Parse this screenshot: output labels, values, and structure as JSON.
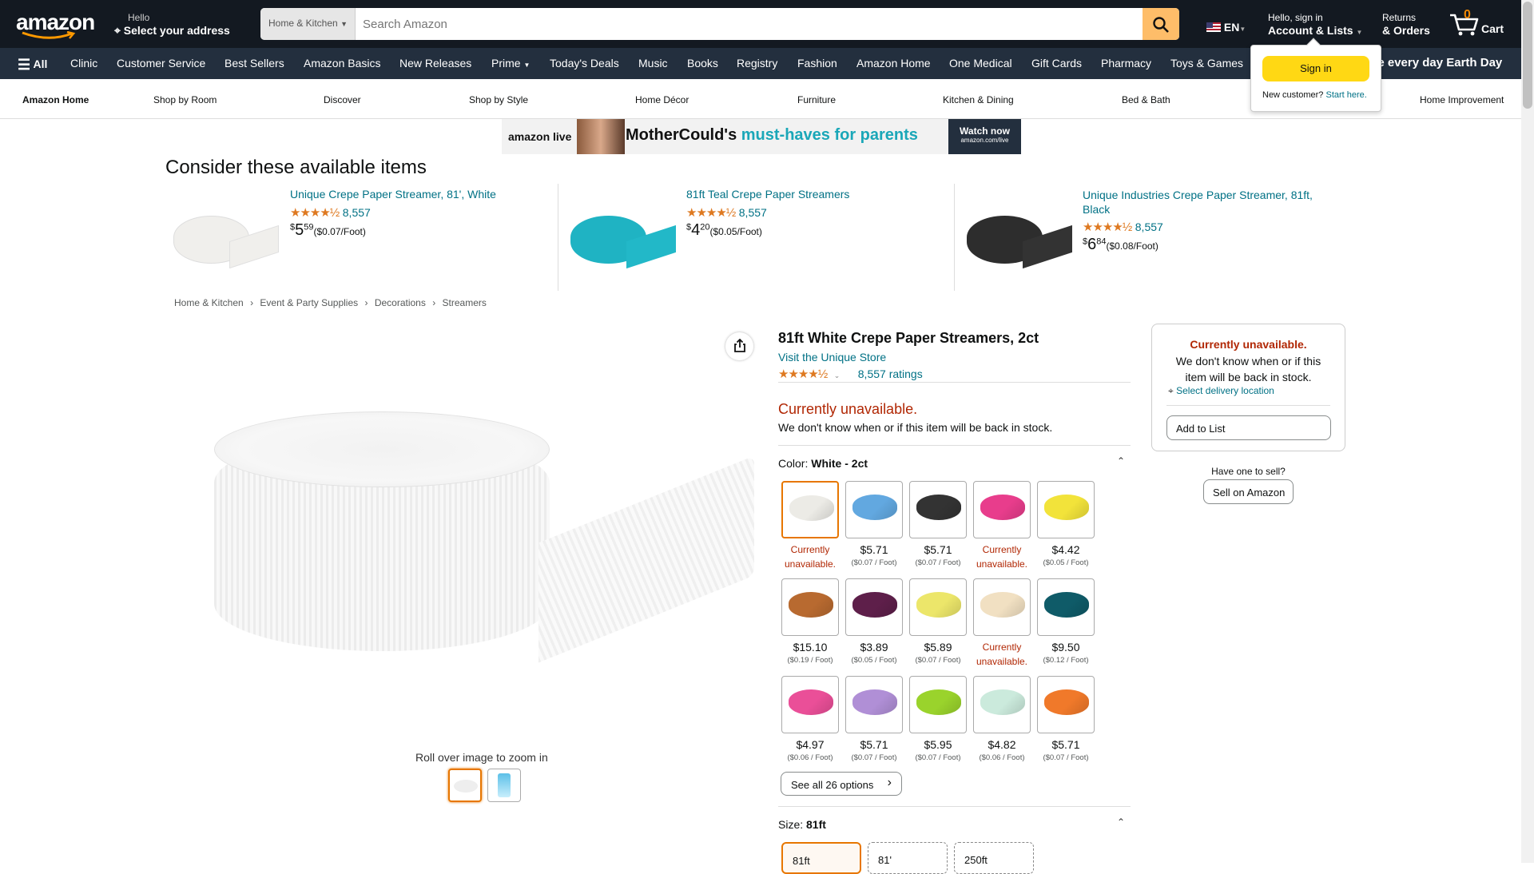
{
  "header": {
    "logo": "amazon",
    "deliver_hello": "Hello",
    "deliver_address": "Select your address",
    "search_category": "Home & Kitchen",
    "search_placeholder": "Search Amazon",
    "language": "EN",
    "account_hello": "Hello, sign in",
    "account_lists": "Account & Lists",
    "returns": "Returns",
    "orders": "& Orders",
    "cart_count": "0",
    "cart_label": "Cart"
  },
  "nav": {
    "all": "All",
    "items": [
      "Clinic",
      "Customer Service",
      "Best Sellers",
      "Amazon Basics",
      "New Releases",
      "Prime",
      "Today's Deals",
      "Music",
      "Books",
      "Registry",
      "Fashion",
      "Amazon Home",
      "One Medical",
      "Gift Cards",
      "Pharmacy",
      "Toys & Games"
    ],
    "promo": "ke every day Earth Day"
  },
  "signin_popup": {
    "button": "Sign in",
    "new_customer": "New customer?",
    "start_here": "Start here."
  },
  "subnav": {
    "items": [
      "Amazon Home",
      "Shop by Room",
      "Discover",
      "Shop by Style",
      "Home Décor",
      "Furniture",
      "Kitchen & Dining",
      "Bed & Bath",
      "Home Improvement"
    ]
  },
  "banner": {
    "brand": "amazon live",
    "text_a": "MotherCould's ",
    "text_b": "must-haves for parents",
    "cta1": "Watch now",
    "cta2": "amazon.com/live"
  },
  "consider": {
    "title": "Consider these available items",
    "items": [
      {
        "title": "Unique Crepe Paper Streamer, 81', White",
        "rating_count": "8,557",
        "price_sym": "$",
        "price_whole": "5",
        "price_frac": "59",
        "unit": "($0.07/Foot)",
        "color": "#f0efec"
      },
      {
        "title": "81ft Teal Crepe Paper Streamers",
        "rating_count": "8,557",
        "price_sym": "$",
        "price_whole": "4",
        "price_frac": "20",
        "unit": "($0.05/Foot)",
        "color": "#1fb3c3"
      },
      {
        "title": "Unique Industries Crepe Paper Streamer, 81ft, Black",
        "rating_count": "8,557",
        "price_sym": "$",
        "price_whole": "6",
        "price_frac": "84",
        "unit": "($0.08/Foot)",
        "color": "#2d2d2d"
      }
    ]
  },
  "breadcrumb": [
    "Home & Kitchen",
    "Event & Party Supplies",
    "Decorations",
    "Streamers"
  ],
  "gallery": {
    "zoom_hint": "Roll over image to zoom in",
    "share_icon": "share-icon"
  },
  "product": {
    "title": "81ft White Crepe Paper Streamers, 2ct",
    "store": "Visit the Unique Store",
    "rating_value": 4.5,
    "ratings": "8,557 ratings",
    "unavailable": "Currently unavailable.",
    "unavailable_desc": "We don't know when or if this item will be back in stock.",
    "color_label": "Color: ",
    "color_value": "White - 2ct",
    "see_all": "See all 26 options",
    "size_label": "Size: ",
    "size_value": "81ft",
    "sizes": [
      "81ft",
      "81'",
      "250ft"
    ]
  },
  "swatches": [
    {
      "color": "#ecebe6",
      "price": "",
      "unit": "",
      "unavailable": "Currently unavailable.",
      "selected": true
    },
    {
      "color": "#62a8e0",
      "price": "$5.71",
      "unit": "($0.07 / Foot)",
      "unavailable": ""
    },
    {
      "color": "#333333",
      "price": "$5.71",
      "unit": "($0.07 / Foot)",
      "unavailable": ""
    },
    {
      "color": "#e83d8c",
      "price": "",
      "unit": "",
      "unavailable": "Currently unavailable."
    },
    {
      "color": "#f2e33a",
      "price": "$4.42",
      "unit": "($0.05 / Foot)",
      "unavailable": ""
    },
    {
      "color": "#b86a30",
      "price": "$15.10",
      "unit": "($0.19 / Foot)",
      "unavailable": ""
    },
    {
      "color": "#5e1f4a",
      "price": "$3.89",
      "unit": "($0.05 / Foot)",
      "unavailable": ""
    },
    {
      "color": "#ece66a",
      "price": "$5.89",
      "unit": "($0.07 / Foot)",
      "unavailable": ""
    },
    {
      "color": "#f1e0c2",
      "price": "",
      "unit": "",
      "unavailable": "Currently unavailable."
    },
    {
      "color": "#0f5b68",
      "price": "$9.50",
      "unit": "($0.12 / Foot)",
      "unavailable": ""
    },
    {
      "color": "#ea4f98",
      "price": "$4.97",
      "unit": "($0.06 / Foot)",
      "unavailable": ""
    },
    {
      "color": "#b08fd6",
      "price": "$5.71",
      "unit": "($0.07 / Foot)",
      "unavailable": ""
    },
    {
      "color": "#9ad32c",
      "price": "$5.95",
      "unit": "($0.07 / Foot)",
      "unavailable": ""
    },
    {
      "color": "#cbeadc",
      "price": "$4.82",
      "unit": "($0.06 / Foot)",
      "unavailable": ""
    },
    {
      "color": "#f0792a",
      "price": "$5.71",
      "unit": "($0.07 / Foot)",
      "unavailable": ""
    }
  ],
  "buybox": {
    "unavailable": "Currently unavailable.",
    "desc": "We don't know when or if this item will be back in stock.",
    "delivery": "Select delivery location",
    "add_to_list": "Add to List",
    "have_one": "Have one to sell?",
    "sell": "Sell on Amazon"
  },
  "colors": {
    "accent": "#febd69",
    "signin": "#ffd814",
    "unavailable": "#b12704",
    "link": "#007185",
    "star": "#de7921"
  }
}
